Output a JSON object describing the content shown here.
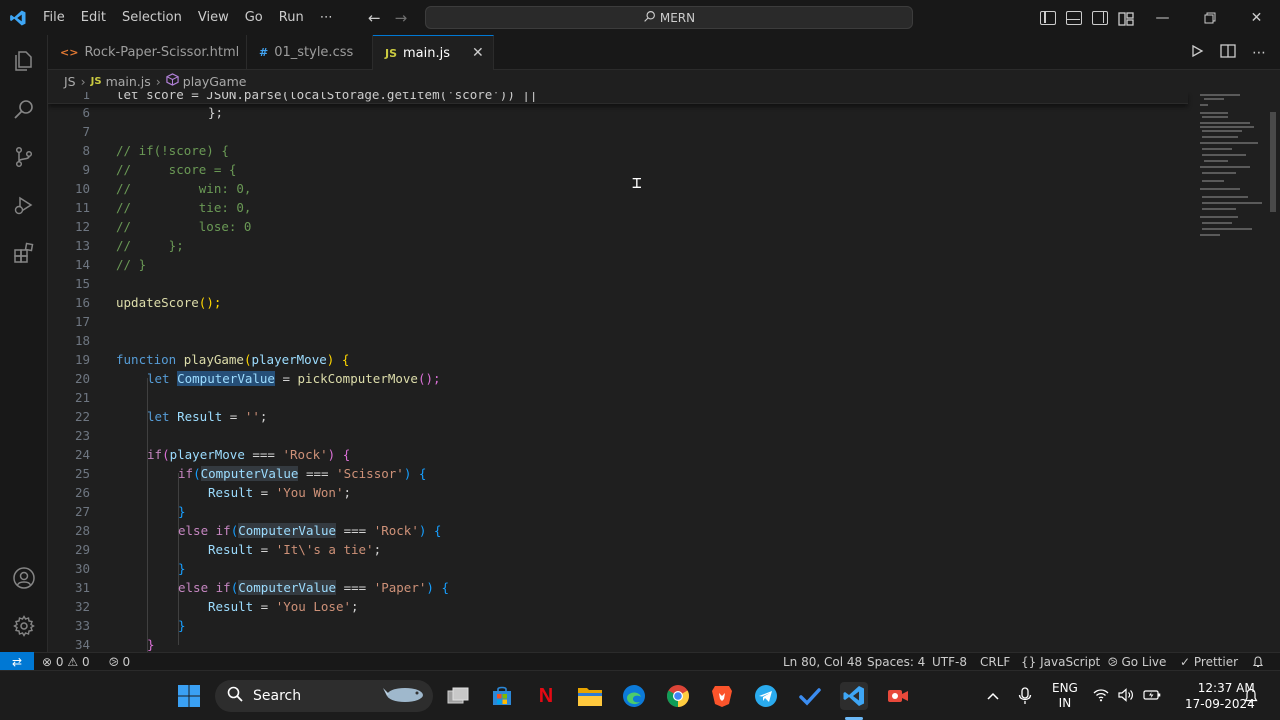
{
  "menu": [
    "File",
    "Edit",
    "Selection",
    "View",
    "Go",
    "Run",
    "⋯"
  ],
  "command_center": {
    "text": "MERN"
  },
  "tabs": [
    {
      "label": "Rock-Paper-Scissor.html",
      "icon": "<>",
      "active": false
    },
    {
      "label": "01_style.css",
      "icon": "#",
      "active": false
    },
    {
      "label": "main.js",
      "icon": "JS",
      "active": true,
      "close": "✕"
    }
  ],
  "breadcrumb": {
    "lang": "JS",
    "file": "main.js",
    "symbol": "playGame"
  },
  "sticky_line": {
    "num": "1",
    "text": "let score = JSON.parse(localStorage.getItem('score')) ||"
  },
  "code_lines": [
    {
      "num": "6"
    },
    {
      "num": "7"
    },
    {
      "num": "8"
    },
    {
      "num": "9"
    },
    {
      "num": "10"
    },
    {
      "num": "11"
    },
    {
      "num": "12"
    },
    {
      "num": "13"
    },
    {
      "num": "14"
    },
    {
      "num": "15"
    },
    {
      "num": "16"
    },
    {
      "num": "17"
    },
    {
      "num": "18"
    },
    {
      "num": "19"
    },
    {
      "num": "20"
    },
    {
      "num": "21"
    },
    {
      "num": "22"
    },
    {
      "num": "23"
    },
    {
      "num": "24"
    },
    {
      "num": "25"
    },
    {
      "num": "26"
    },
    {
      "num": "27"
    },
    {
      "num": "28"
    },
    {
      "num": "29"
    },
    {
      "num": "30"
    },
    {
      "num": "31"
    },
    {
      "num": "32"
    },
    {
      "num": "33"
    },
    {
      "num": "34"
    }
  ],
  "code": {
    "l6": "};",
    "l8": "// if(!score) {",
    "l9": "//     score = {",
    "l10": "//         win: 0,",
    "l11": "//         tie: 0,",
    "l12": "//         lose: 0",
    "l13": "//     };",
    "l14": "// }",
    "l16a": "updateScore",
    "l16b": "();",
    "l19a": "function",
    "l19b": "playGame",
    "l19c": "(",
    "l19d": "playerMove",
    "l19e": ")",
    "l19f": "{",
    "l20a": "let",
    "l20b": "ComputerValue",
    "l20c": " = ",
    "l20d": "pickComputerMove",
    "l20e": "();",
    "l22a": "let",
    "l22b": "Result",
    "l22c": " = ",
    "l22d": "''",
    "l22e": ";",
    "l24a": "if",
    "l24b": "(",
    "l24c": "playerMove",
    "l24d": " === ",
    "l24e": "'Rock'",
    "l24f": ")",
    "l24g": "{",
    "l25a": "if",
    "l25b": "(",
    "l25c": "ComputerValue",
    "l25d": " === ",
    "l25e": "'Scissor'",
    "l25f": ")",
    "l25g": "{",
    "l26a": "Result",
    "l26b": " = ",
    "l26c": "'You Won'",
    "l26d": ";",
    "l27": "}",
    "l28a": "else if",
    "l28b": "(",
    "l28c": "ComputerValue",
    "l28d": " === ",
    "l28e": "'Rock'",
    "l28f": ")",
    "l28g": "{",
    "l29a": "Result",
    "l29b": " = ",
    "l29c": "'It\\'s a tie'",
    "l29d": ";",
    "l30": "}",
    "l31a": "else if",
    "l31b": "(",
    "l31c": "ComputerValue",
    "l31d": " === ",
    "l31e": "'Paper'",
    "l31f": ")",
    "l31g": "{",
    "l32a": "Result",
    "l32b": " = ",
    "l32c": "'You Lose'",
    "l32d": ";",
    "l33": "}",
    "l34": "}"
  },
  "status": {
    "errors": "0",
    "warnings": "0",
    "ports": "0",
    "position": "Ln 80, Col 48",
    "spaces": "Spaces: 4",
    "encoding": "UTF-8",
    "eol": "CRLF",
    "language": "JavaScript",
    "golive": "Go Live",
    "prettier": "Prettier"
  },
  "taskbar": {
    "search_label": "Search",
    "lang_top": "ENG",
    "lang_bottom": "IN",
    "time": "12:37 AM",
    "date": "17-09-2024"
  },
  "colors": {
    "accent": "#0078d4",
    "editor_bg": "#1f1f1f",
    "chrome_bg": "#181818"
  }
}
